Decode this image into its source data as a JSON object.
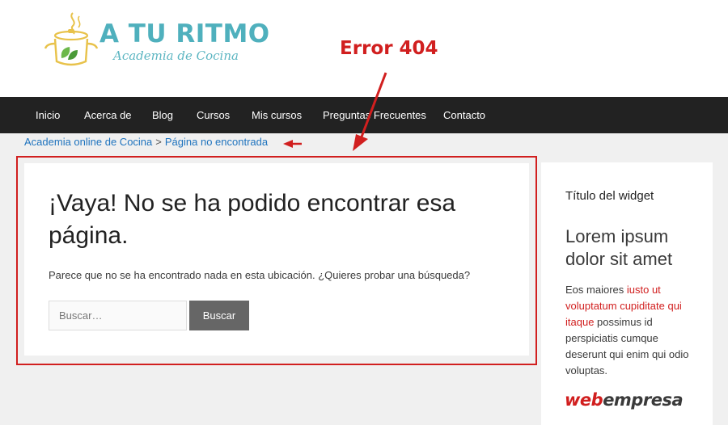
{
  "logo": {
    "title": "A TU RITMO",
    "subtitle": "Academia de Cocina"
  },
  "annotation": {
    "error_label": "Error 404",
    "color": "#d11f1f"
  },
  "nav": {
    "items": [
      "Inicio",
      "Acerca de",
      "Blog",
      "Cursos",
      "Mis cursos",
      "Preguntas Frecuentes",
      "Contacto"
    ]
  },
  "breadcrumb": {
    "home": "Academia online de Cocina",
    "separator": ">",
    "current": "Página no encontrada"
  },
  "main": {
    "title": "¡Vaya! No se ha podido encontrar esa página.",
    "text": "Parece que no se ha encontrado nada en esta ubicación. ¿Quieres probar una búsqueda?",
    "search_placeholder": "Buscar…",
    "search_button": "Buscar"
  },
  "sidebar": {
    "widget_title": "Título del widget",
    "heading": "Lorem ipsum dolor sit amet",
    "text_before": "Eos maiores ",
    "text_link": "iusto ut voluptatum cupiditate qui itaque",
    "text_after": " possimus id perspiciatis cumque deserunt qui enim qui odio voluptas.",
    "brand_part1": "web",
    "brand_part2": "empresa"
  },
  "colors": {
    "accent_teal": "#4fb0bd",
    "nav_background": "#222222",
    "link_blue": "#1e73be",
    "highlight_red": "#d11f1f"
  }
}
